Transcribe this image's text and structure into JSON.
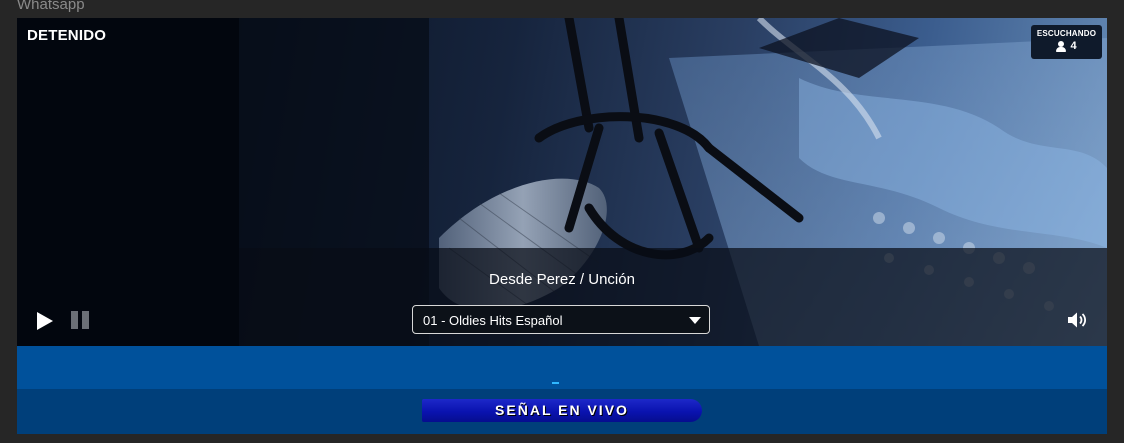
{
  "page": {
    "top_label": "Whatsapp"
  },
  "player": {
    "status": "DETENIDO",
    "listeners": {
      "label": "ESCUCHANDO",
      "count": "4",
      "icon": "user-icon"
    },
    "station_title": "Desde Perez / Unción",
    "track_select": {
      "selected": "01 - Oldies Hits Español"
    },
    "controls": {
      "play_icon": "play-icon",
      "pause_icon": "pause-icon",
      "volume_icon": "volume-icon"
    }
  },
  "footer": {
    "live_banner": "SEÑAL EN VIVO"
  },
  "colors": {
    "page_background": "#262626",
    "band_blue": "#00519b",
    "band_dark": "#003f7a",
    "banner_blue": "#0a13b0",
    "dash_accent": "#2fb7ff"
  }
}
